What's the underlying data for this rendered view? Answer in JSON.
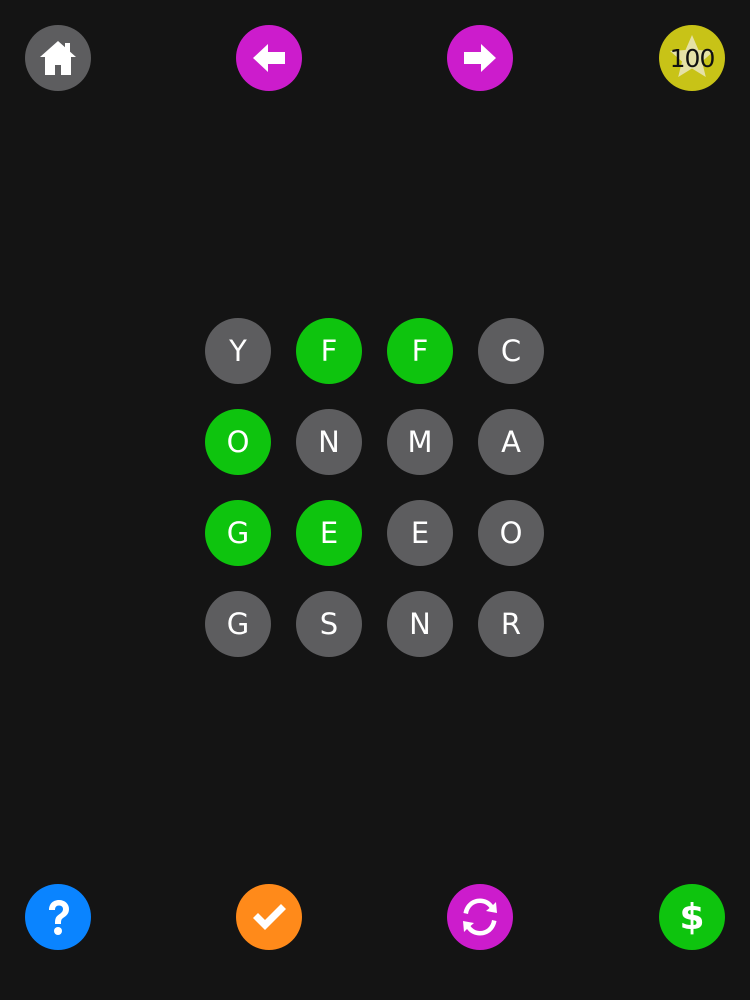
{
  "colors": {
    "background": "#141414",
    "tile_default": "#5d5d5f",
    "tile_selected": "#0ec40e",
    "home": "#5d5d5f",
    "nav": "#cc1ccc",
    "coins": "#c8c317",
    "help": "#0a84ff",
    "check": "#ff8a1a",
    "shuffle": "#cc1ccc",
    "store": "#0ec40e"
  },
  "toolbar": {
    "coins": "100"
  },
  "board": {
    "rows": [
      [
        {
          "letter": "Y",
          "selected": false
        },
        {
          "letter": "F",
          "selected": true
        },
        {
          "letter": "F",
          "selected": true
        },
        {
          "letter": "C",
          "selected": false
        }
      ],
      [
        {
          "letter": "O",
          "selected": true
        },
        {
          "letter": "N",
          "selected": false
        },
        {
          "letter": "M",
          "selected": false
        },
        {
          "letter": "A",
          "selected": false
        }
      ],
      [
        {
          "letter": "G",
          "selected": true
        },
        {
          "letter": "E",
          "selected": true
        },
        {
          "letter": "E",
          "selected": false
        },
        {
          "letter": "O",
          "selected": false
        }
      ],
      [
        {
          "letter": "G",
          "selected": false
        },
        {
          "letter": "S",
          "selected": false
        },
        {
          "letter": "N",
          "selected": false
        },
        {
          "letter": "R",
          "selected": false
        }
      ]
    ]
  },
  "icons": {
    "home": "home-icon",
    "prev": "arrow-left-icon",
    "next": "arrow-right-icon",
    "coins": "star-icon",
    "help": "question-icon",
    "check": "checkmark-icon",
    "shuffle": "refresh-icon",
    "store": "dollar-icon"
  }
}
